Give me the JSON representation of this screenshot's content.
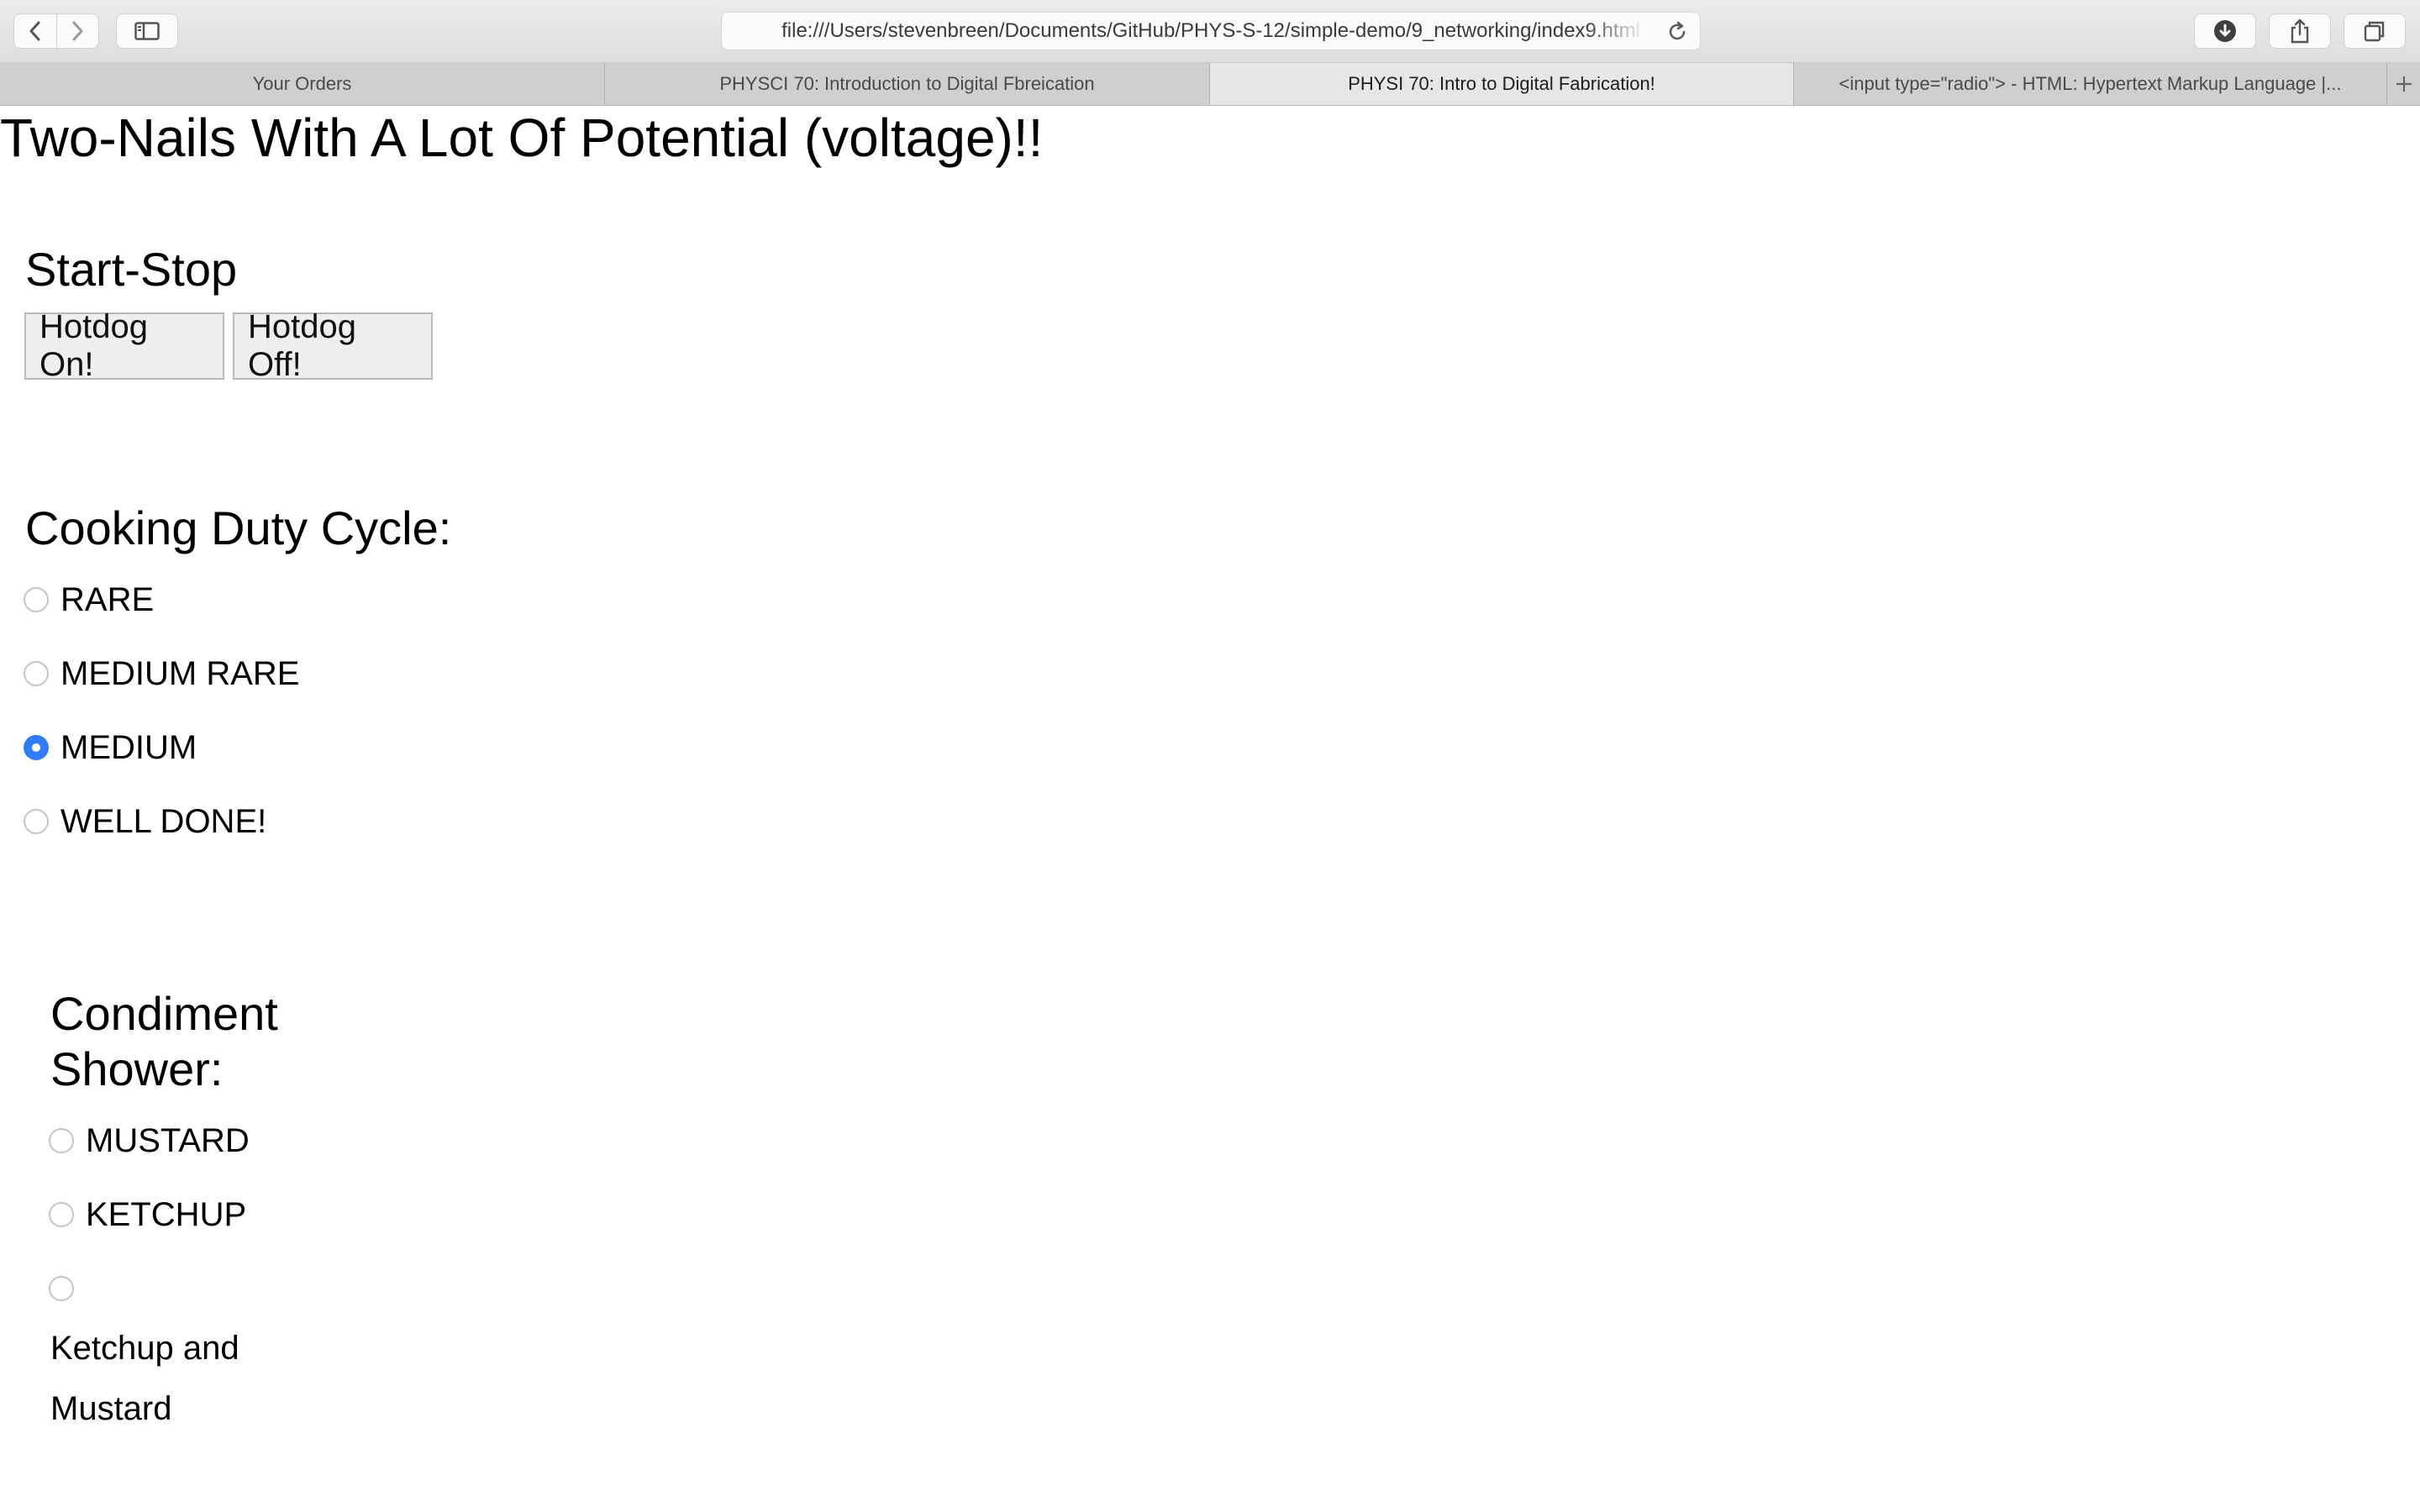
{
  "browser": {
    "url": "file:///Users/stevenbreen/Documents/GitHub/PHYS-S-12/simple-demo/9_networking/index9.html",
    "tabs": [
      {
        "label": "Your Orders",
        "active": false
      },
      {
        "label": "PHYSCI 70: Introduction to Digital Fbreication",
        "active": false
      },
      {
        "label": "PHYSI 70: Intro to Digital Fabrication!",
        "active": true
      },
      {
        "label": "<input type=\"radio\"> - HTML: Hypertext Markup Language |...",
        "active": false
      }
    ],
    "icons": {
      "back": "chevron-left-icon",
      "forward": "chevron-right-icon",
      "sidebar": "sidebar-icon",
      "reload": "reload-icon",
      "download": "download-icon",
      "share": "share-icon",
      "tabs": "tabs-overview-icon",
      "new_tab": "plus-icon"
    }
  },
  "page": {
    "title": "Two-Nails With A Lot Of Potential (voltage)!!",
    "start_stop": {
      "heading": "Start-Stop",
      "on_label": "Hotdog On!",
      "off_label": "Hotdog Off!"
    },
    "duty_cycle": {
      "heading": "Cooking Duty Cycle:",
      "options": [
        {
          "label": "RARE",
          "checked": false
        },
        {
          "label": "MEDIUM RARE",
          "checked": false
        },
        {
          "label": "MEDIUM",
          "checked": true
        },
        {
          "label": "WELL DONE!",
          "checked": false
        }
      ]
    },
    "condiments": {
      "heading_line1": "Condiment",
      "heading_line2": "Shower:",
      "options": [
        {
          "label": "MUSTARD",
          "checked": false
        },
        {
          "label": "KETCHUP",
          "checked": false
        },
        {
          "label_line1": "Ketchup and",
          "label_line2": "Mustard",
          "checked": false
        }
      ]
    },
    "accent_color": "#2f7cf6"
  }
}
